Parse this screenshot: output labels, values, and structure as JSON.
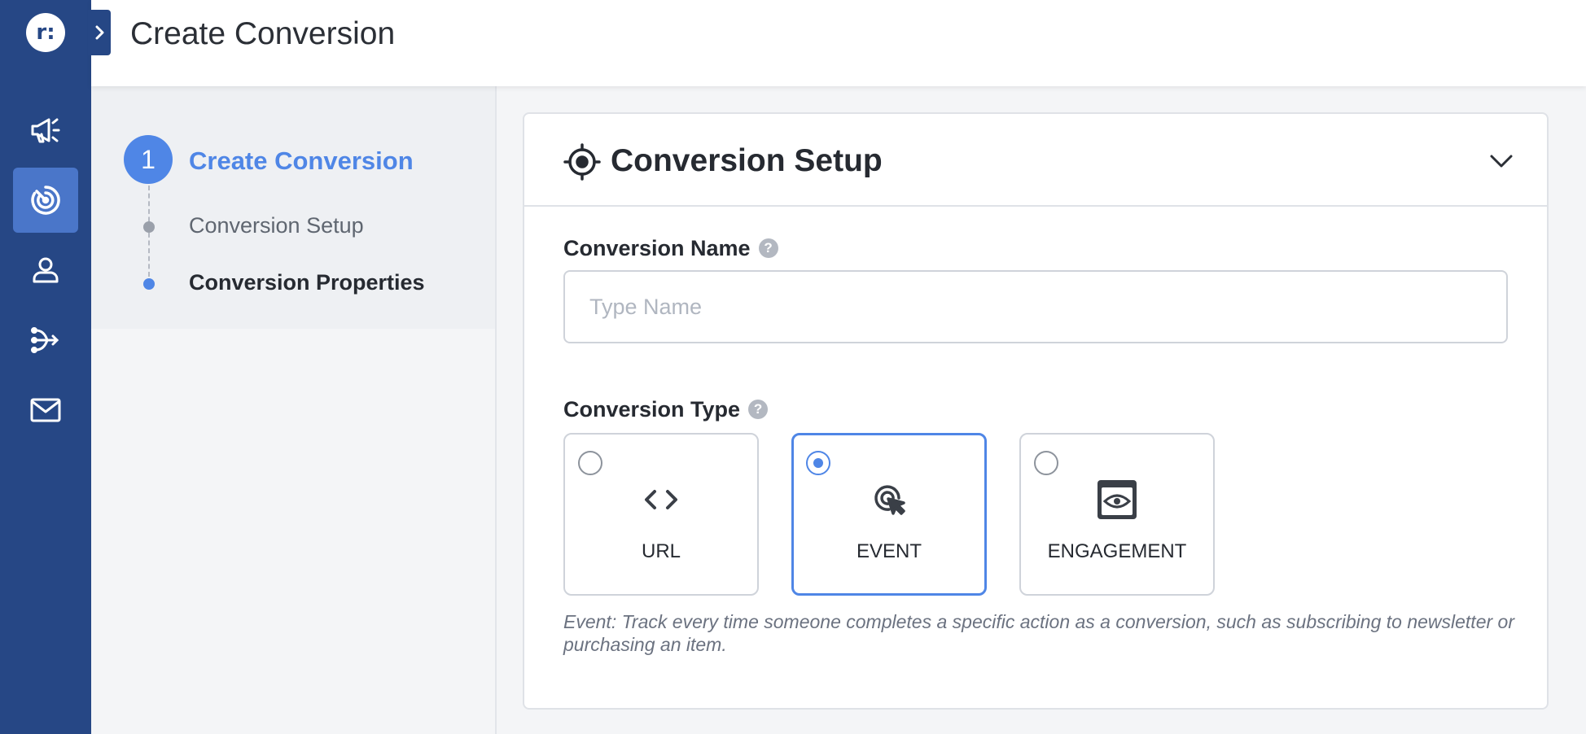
{
  "app": {
    "logo_text": "r:",
    "nav_items": [
      "megaphone-icon",
      "target-icon",
      "user-icon",
      "flow-icon",
      "mail-icon"
    ],
    "active_nav": "target-icon",
    "accent_color": "#4f86e6",
    "nav_color": "#264785"
  },
  "header": {
    "title": "Create Conversion"
  },
  "stepper": {
    "step_number": "1",
    "step_title": "Create Conversion",
    "substeps": [
      {
        "label": "Conversion Setup",
        "state": "completed"
      },
      {
        "label": "Conversion Properties",
        "state": "current"
      }
    ]
  },
  "card": {
    "title": "Conversion Setup",
    "name_field": {
      "label": "Conversion Name",
      "help": "?",
      "placeholder": "Type Name",
      "value": ""
    },
    "type_field": {
      "label": "Conversion Type",
      "help": "?",
      "options": [
        {
          "label": "URL",
          "icon": "code-icon",
          "selected": false
        },
        {
          "label": "EVENT",
          "icon": "click-target-icon",
          "selected": true
        },
        {
          "label": "ENGAGEMENT",
          "icon": "eye-window-icon",
          "selected": false
        }
      ],
      "description": "Event: Track every time someone completes a specific action as a conversion, such as subscribing to newsletter or purchasing an item."
    }
  }
}
